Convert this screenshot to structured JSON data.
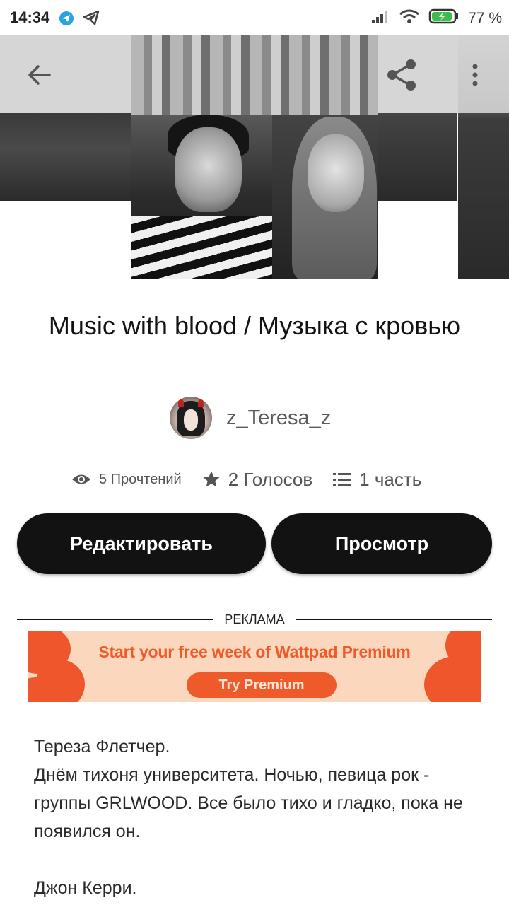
{
  "status_bar": {
    "time": "14:34",
    "battery": "77 %"
  },
  "story": {
    "title": "Music with blood / Музыка с кровью",
    "author": "z_Teresa_z",
    "reads": "5 Прочтений",
    "votes": "2 Голосов",
    "parts": "1 часть"
  },
  "actions": {
    "edit": "Редактировать",
    "preview": "Просмотр"
  },
  "ad": {
    "label": "РЕКЛАМА",
    "headline": "Start your free week of Wattpad Premium",
    "cta": "Try Premium"
  },
  "description": {
    "line1": "Тереза Флетчер.",
    "line2": " Днём тихоня университета. Ночью, певица рок - группы GRLWOOD. Все было тихо и гладко, пока не появился он.",
    "line3": "Джон Керри."
  },
  "colors": {
    "button_bg": "#121212",
    "ad_orange": "#ef5a2b",
    "ad_bg": "#fbd8bd"
  }
}
